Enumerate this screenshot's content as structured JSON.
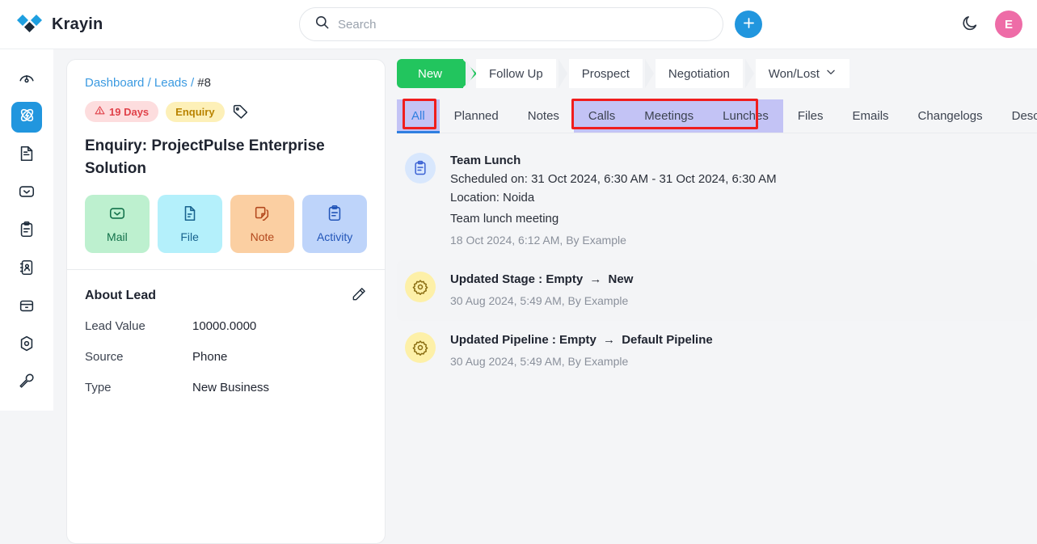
{
  "app": {
    "brand_name": "Krayin",
    "logo_icon": "krayin-diamond-logo"
  },
  "header": {
    "search_placeholder": "Search",
    "search_value": "",
    "search_icon": "search-icon",
    "create_button_icon": "plus-icon",
    "theme_toggle_icon": "moon-icon",
    "avatar_initial": "E"
  },
  "sidebar": {
    "items": [
      {
        "name": "dashboard",
        "icon": "speedometer-icon",
        "active": false
      },
      {
        "name": "leads",
        "icon": "leads-atom-icon",
        "active": true
      },
      {
        "name": "quotes",
        "icon": "document-icon",
        "active": false
      },
      {
        "name": "mail",
        "icon": "envelope-icon",
        "active": false
      },
      {
        "name": "activities",
        "icon": "clipboard-icon",
        "active": false
      },
      {
        "name": "contacts",
        "icon": "address-book-icon",
        "active": false
      },
      {
        "name": "products",
        "icon": "box-icon",
        "active": false
      },
      {
        "name": "settings",
        "icon": "hexagon-gear-icon",
        "active": false
      },
      {
        "name": "configuration",
        "icon": "wrench-icon",
        "active": false
      }
    ]
  },
  "lead": {
    "breadcrumb": {
      "dashboard": "Dashboard",
      "leads": "Leads",
      "separator": "/",
      "current": "#8"
    },
    "badges": {
      "days": "19 Days",
      "days_icon": "warning-triangle-icon",
      "type": "Enquiry",
      "tag_icon": "tag-icon"
    },
    "title": "Enquiry: ProjectPulse Enterprise Solution",
    "quick_actions": [
      {
        "label": "Mail",
        "icon": "envelope-icon",
        "color": "#bdf0cf"
      },
      {
        "label": "File",
        "icon": "file-icon",
        "color": "#b4f0fb"
      },
      {
        "label": "Note",
        "icon": "note-icon",
        "color": "#fbcfa2"
      },
      {
        "label": "Activity",
        "icon": "clipboard-icon",
        "color": "#bed4fa"
      }
    ],
    "about": {
      "title": "About Lead",
      "edit_icon": "pencil-icon",
      "rows": [
        {
          "key": "Lead Value",
          "value": "10000.0000"
        },
        {
          "key": "Source",
          "value": "Phone"
        },
        {
          "key": "Type",
          "value": "New Business"
        }
      ]
    }
  },
  "pipeline": {
    "stages": [
      {
        "label": "New",
        "active": true
      },
      {
        "label": "Follow Up",
        "active": false
      },
      {
        "label": "Prospect",
        "active": false
      },
      {
        "label": "Negotiation",
        "active": false
      },
      {
        "label": "Won/Lost",
        "active": false,
        "caret_icon": "chevron-down-icon"
      }
    ],
    "active_color": "#22c55e"
  },
  "tabs": {
    "items": [
      {
        "label": "All",
        "active": true,
        "highlight": true
      },
      {
        "label": "Planned",
        "active": false,
        "highlight": false
      },
      {
        "label": "Notes",
        "active": false,
        "highlight": false
      },
      {
        "label": "Calls",
        "active": false,
        "highlight": true
      },
      {
        "label": "Meetings",
        "active": false,
        "highlight": true
      },
      {
        "label": "Lunches",
        "active": false,
        "highlight": true
      },
      {
        "label": "Files",
        "active": false,
        "highlight": false
      },
      {
        "label": "Emails",
        "active": false,
        "highlight": false
      },
      {
        "label": "Changelogs",
        "active": false,
        "highlight": false
      },
      {
        "label": "Description",
        "active": false,
        "highlight": false
      }
    ],
    "highlight_color": "#c3c3f5",
    "annotation_color": "#f01d1d",
    "active_underline_color": "#2f7fe0"
  },
  "activities": [
    {
      "icon": "clipboard-icon",
      "icon_style": "blue",
      "title": "Team Lunch",
      "schedule": "Scheduled on: 31 Oct 2024, 6:30 AM - 31 Oct 2024, 6:30 AM",
      "location": "Location: Noida",
      "description": "Team lunch meeting",
      "meta": "18 Oct 2024, 6:12 AM, By Example",
      "hovered": false
    },
    {
      "icon": "gear-icon",
      "icon_style": "yellow",
      "title_prefix": "Updated Stage : Empty",
      "arrow": "→",
      "title_suffix": "New",
      "meta": "30 Aug 2024, 5:49 AM, By Example",
      "hovered": true
    },
    {
      "icon": "gear-icon",
      "icon_style": "yellow",
      "title_prefix": "Updated Pipeline : Empty",
      "arrow": "→",
      "title_suffix": "Default Pipeline",
      "meta": "30 Aug 2024, 5:49 AM, By Example",
      "hovered": false
    }
  ]
}
